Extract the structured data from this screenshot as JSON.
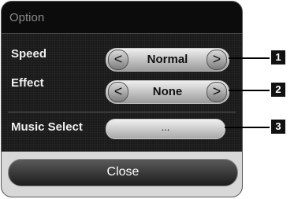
{
  "dialog": {
    "title": "Option",
    "rows": [
      {
        "label": "Speed",
        "value": "Normal",
        "prev_icon": "chevron-left-icon",
        "next_icon": "chevron-right-icon"
      },
      {
        "label": "Effect",
        "value": "None",
        "prev_icon": "chevron-left-icon",
        "next_icon": "chevron-right-icon"
      }
    ],
    "music": {
      "label": "Music Select",
      "button_text": "..."
    },
    "close_label": "Close"
  },
  "glyphs": {
    "prev": "<",
    "next": ">"
  },
  "callouts": [
    "1",
    "2",
    "3"
  ]
}
